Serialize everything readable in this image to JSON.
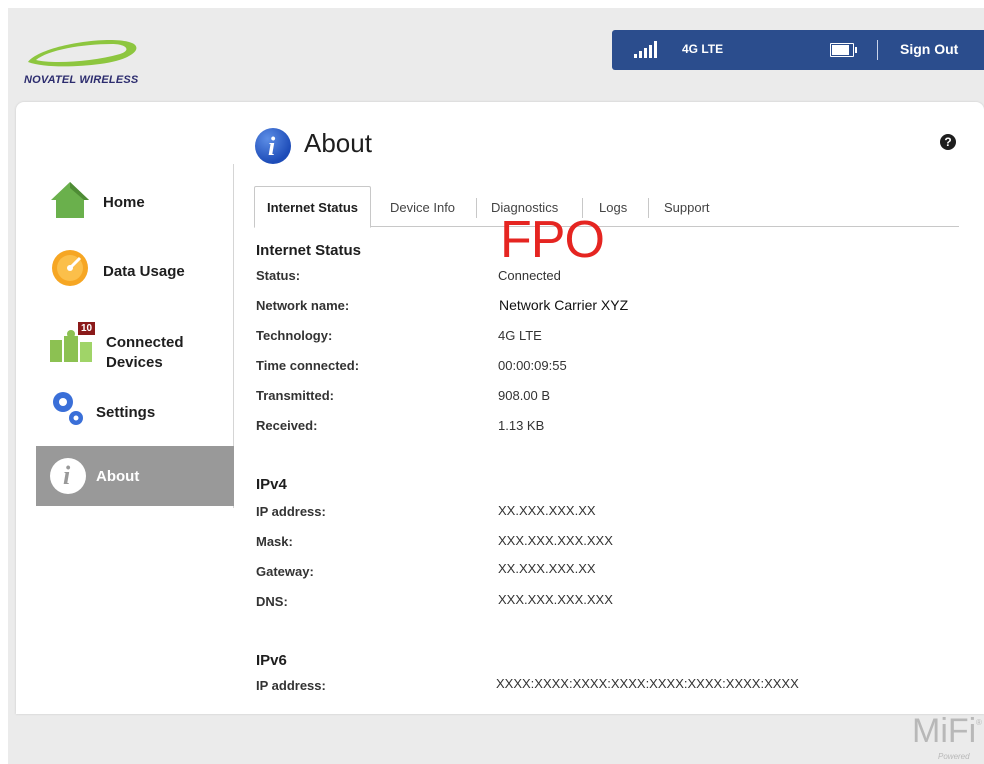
{
  "brand": {
    "logo_text": "NOVATEL WIRELESS",
    "product_mark": "MiFi",
    "product_sub": "Powered"
  },
  "status_bar": {
    "network_type": "4G LTE",
    "sign_out_label": "Sign Out"
  },
  "sidebar": {
    "items": [
      {
        "label": "Home",
        "icon": "home-icon"
      },
      {
        "label": "Data Usage",
        "icon": "gauge-icon"
      },
      {
        "label_line1": "Connected",
        "label_line2": "Devices",
        "icon": "devices-icon",
        "badge": "10"
      },
      {
        "label": "Settings",
        "icon": "gear-icon"
      },
      {
        "label": "About",
        "icon": "info-icon",
        "active": true
      }
    ]
  },
  "page": {
    "title": "About",
    "help": "?"
  },
  "tabs": [
    {
      "label": "Internet Status",
      "active": true
    },
    {
      "label": "Device Info"
    },
    {
      "label": "Diagnostics"
    },
    {
      "label": "Logs"
    },
    {
      "label": "Support"
    }
  ],
  "watermark": "FPO",
  "internet_status": {
    "heading": "Internet Status",
    "rows": [
      {
        "label": "Status:",
        "value": "Connected"
      },
      {
        "label": "Network name:",
        "value": "Network Carrier XYZ"
      },
      {
        "label": "Technology:",
        "value": "4G LTE"
      },
      {
        "label": "Time connected:",
        "value": "00:00:09:55"
      },
      {
        "label": "Transmitted:",
        "value": "908.00 B"
      },
      {
        "label": "Received:",
        "value": "1.13 KB"
      }
    ]
  },
  "ipv4": {
    "heading": "IPv4",
    "rows": [
      {
        "label": "IP address:",
        "value": "XX.XXX.XXX.XX"
      },
      {
        "label": "Mask:",
        "value": "XXX.XXX.XXX.XXX"
      },
      {
        "label": "Gateway:",
        "value": "XX.XXX.XXX.XX"
      },
      {
        "label": "DNS:",
        "value": "XXX.XXX.XXX.XXX"
      }
    ]
  },
  "ipv6": {
    "heading": "IPv6",
    "rows": [
      {
        "label": "IP address:",
        "value": "XXXX:XXXX:XXXX:XXXX:XXXX:XXXX:XXXX:XXXX"
      }
    ]
  },
  "colors": {
    "status_bar": "#2b4d8d",
    "active_nav": "#999999",
    "badge": "#8b1a1a",
    "fpo": "#e52521",
    "logo": "#8dc63f"
  }
}
